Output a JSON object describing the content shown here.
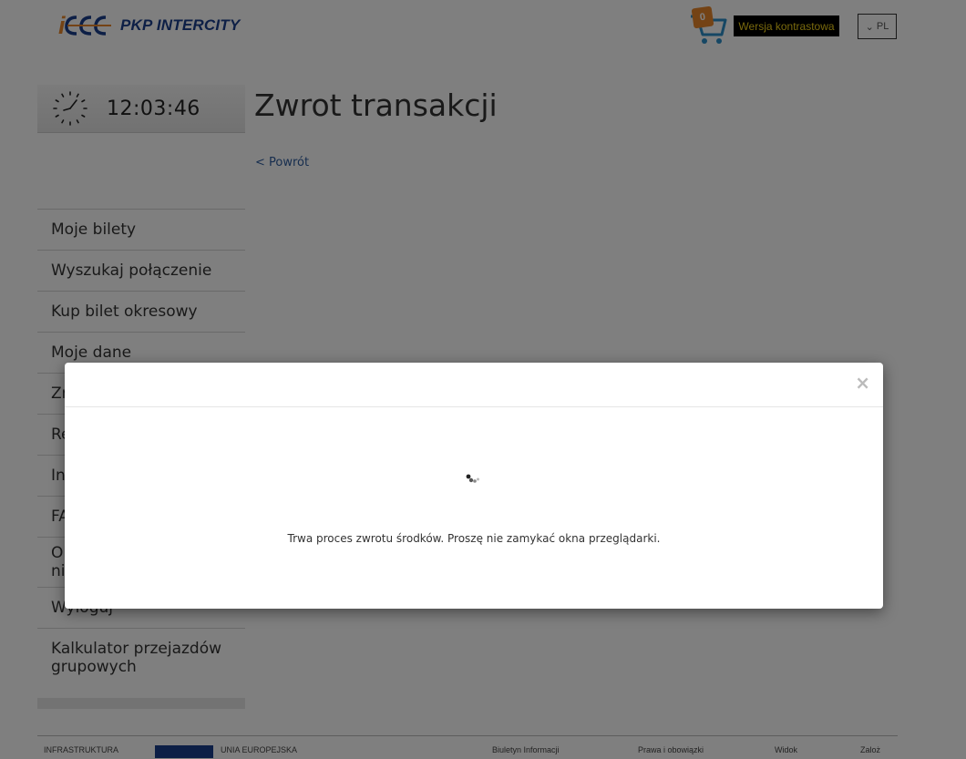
{
  "header": {
    "logo_text": "PKP INTERCITY",
    "cart_count": "0",
    "contrast_label": "Wersja kontrastowa",
    "language": "PL",
    "brand_colors": {
      "blue": "#1a3e8c",
      "orange": "#e8862a",
      "cart_blue": "#2d8fc9"
    }
  },
  "clock": {
    "time": "12:03:46"
  },
  "main": {
    "title": "Zwrot transakcji",
    "back_label": "< Powrót"
  },
  "sidebar": {
    "items": [
      {
        "label": "Moje bilety"
      },
      {
        "label": "Wyszukaj połączenie"
      },
      {
        "label": "Kup bilet okresowy"
      },
      {
        "label": "Moje dane"
      },
      {
        "label": "Zm"
      },
      {
        "label": "Re"
      },
      {
        "label": "In"
      },
      {
        "label": "FA"
      },
      {
        "label": "Ol\nni"
      },
      {
        "label": "Wyloguj"
      },
      {
        "label": "Kalkulator przejazdów grupowych"
      }
    ]
  },
  "footer": {
    "items": [
      "INFRASTRUKTURA",
      "UNIA EUROPEJSKA",
      "Biuletyn Informacji",
      "Prawa i obowiązki",
      "Widok",
      "Zaloż"
    ]
  },
  "modal": {
    "close_symbol": "×",
    "message": "Trwa proces zwrotu środków. Proszę nie zamykać okna przeglądarki."
  }
}
